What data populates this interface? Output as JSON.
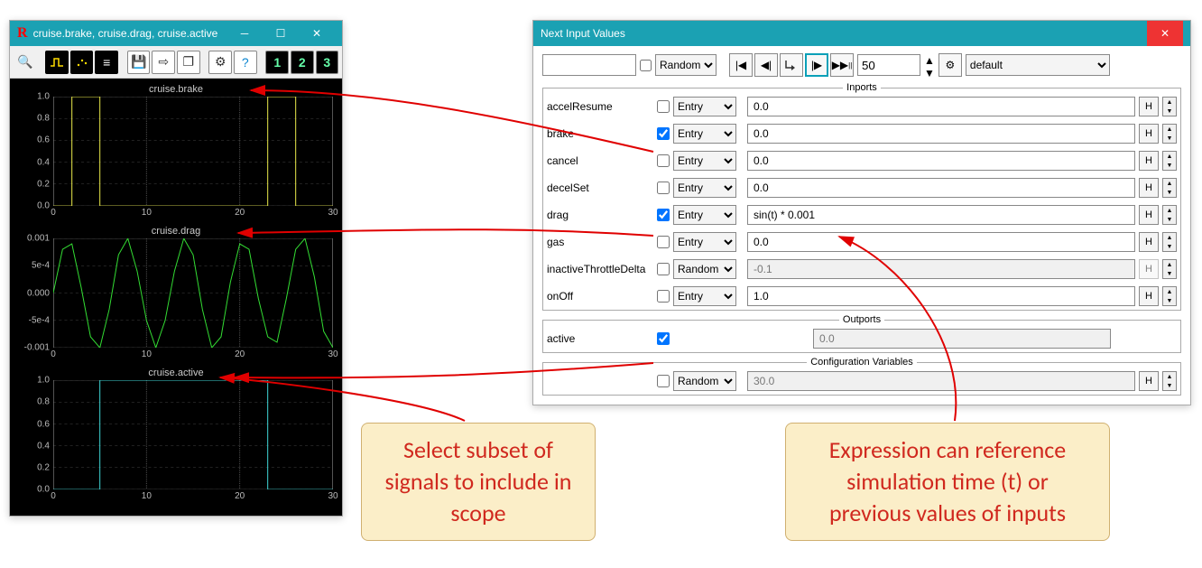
{
  "plots_window": {
    "title": "cruise.brake, cruise.drag, cruise.active",
    "toolbar_icons": [
      "search",
      "mode-xt",
      "mode-points",
      "mode-bars",
      "save",
      "export",
      "copy",
      "settings",
      "help",
      "1",
      "2",
      "3"
    ],
    "plots": [
      {
        "title": "cruise.brake",
        "yticks": [
          "1.0",
          "0.8",
          "0.6",
          "0.4",
          "0.2",
          "0.0"
        ],
        "xticks": [
          "0",
          "10",
          "20",
          "30"
        ],
        "color": "#e8e84a"
      },
      {
        "title": "cruise.drag",
        "yticks": [
          "0.001",
          "5e-4",
          "0.000",
          "-5e-4",
          "-0.001"
        ],
        "xticks": [
          "0",
          "10",
          "20",
          "30"
        ],
        "color": "#33dd33"
      },
      {
        "title": "cruise.active",
        "yticks": [
          "1.0",
          "0.8",
          "0.6",
          "0.4",
          "0.2",
          "0.0"
        ],
        "xticks": [
          "0",
          "10",
          "20",
          "30"
        ],
        "color": "#3fd6d6"
      }
    ]
  },
  "inputs_window": {
    "title": "Next Input Values",
    "top": {
      "mode": "Random",
      "steps": "50",
      "target": "default"
    },
    "inports_label": "Inports",
    "outports_label": "Outports",
    "configvars_label": "Configuration Variables",
    "hbtn_label": "H",
    "inports": [
      {
        "name": "accelResume",
        "checked": false,
        "kind": "Entry",
        "value": "0.0",
        "enabled": true
      },
      {
        "name": "brake",
        "checked": true,
        "kind": "Entry",
        "value": "0.0",
        "enabled": true
      },
      {
        "name": "cancel",
        "checked": false,
        "kind": "Entry",
        "value": "0.0",
        "enabled": true
      },
      {
        "name": "decelSet",
        "checked": false,
        "kind": "Entry",
        "value": "0.0",
        "enabled": true
      },
      {
        "name": "drag",
        "checked": true,
        "kind": "Entry",
        "value": "sin(t) * 0.001",
        "enabled": true
      },
      {
        "name": "gas",
        "checked": false,
        "kind": "Entry",
        "value": "0.0",
        "enabled": true
      },
      {
        "name": "inactiveThrottleDelta",
        "checked": false,
        "kind": "Random",
        "value": "-0.1",
        "enabled": false
      },
      {
        "name": "onOff",
        "checked": false,
        "kind": "Entry",
        "value": "1.0",
        "enabled": true
      }
    ],
    "outports": [
      {
        "name": "active",
        "checked": true,
        "value": "0.0"
      }
    ],
    "configvars": [
      {
        "checked": false,
        "kind": "Random",
        "value": "30.0"
      }
    ]
  },
  "callouts": {
    "left": "Select subset of signals to include in scope",
    "right": "Expression can reference simulation time (t) or previous values of inputs"
  },
  "chart_data": [
    {
      "type": "line",
      "title": "cruise.brake",
      "xlabel": "",
      "ylabel": "",
      "xlim": [
        0,
        30
      ],
      "ylim": [
        0.0,
        1.0
      ],
      "x": [
        0,
        2,
        2,
        5,
        5,
        23,
        23,
        26,
        26,
        30
      ],
      "values": [
        0,
        0,
        1,
        1,
        0,
        0,
        1,
        1,
        0,
        0
      ]
    },
    {
      "type": "line",
      "title": "cruise.drag",
      "xlabel": "",
      "ylabel": "",
      "xlim": [
        0,
        30
      ],
      "ylim": [
        -0.001,
        0.001
      ],
      "x": [
        0,
        1,
        2,
        3,
        4,
        5,
        6,
        7,
        8,
        9,
        10,
        11,
        12,
        13,
        14,
        15,
        16,
        17,
        18,
        19,
        20,
        21,
        22,
        23,
        24,
        25,
        26,
        27,
        28,
        29,
        30
      ],
      "values": [
        0.0,
        0.0008,
        0.0009,
        0.0001,
        -0.0008,
        -0.001,
        -0.0003,
        0.0007,
        0.001,
        0.0004,
        -0.0005,
        -0.001,
        -0.0005,
        0.0004,
        0.001,
        0.0007,
        -0.0003,
        -0.001,
        -0.0008,
        0.0002,
        0.0009,
        0.0008,
        -0.0001,
        -0.0008,
        -0.0009,
        -0.0001,
        0.0008,
        0.001,
        0.0003,
        -0.0007,
        -0.001
      ]
    },
    {
      "type": "line",
      "title": "cruise.active",
      "xlabel": "",
      "ylabel": "",
      "xlim": [
        0,
        30
      ],
      "ylim": [
        0.0,
        1.0
      ],
      "x": [
        0,
        5,
        5,
        23,
        23,
        30
      ],
      "values": [
        0,
        0,
        1,
        1,
        0,
        0
      ]
    }
  ]
}
